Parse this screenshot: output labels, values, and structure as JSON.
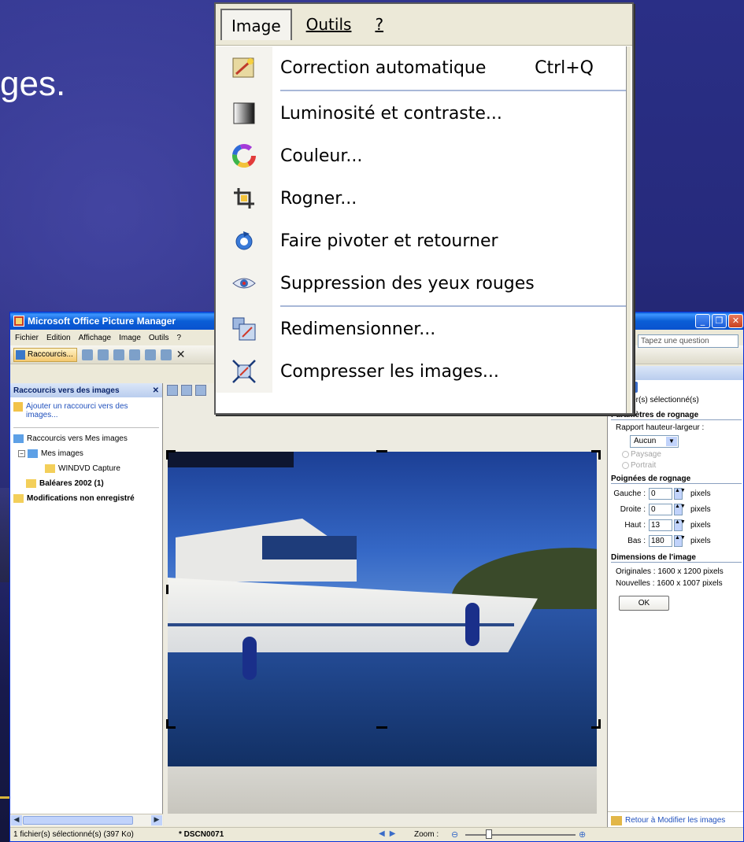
{
  "slide": {
    "title_fragment": "ges."
  },
  "window": {
    "title": "Microsoft Office Picture Manager",
    "menu": [
      "Fichier",
      "Edition",
      "Affichage",
      "Image",
      "Outils",
      "?"
    ],
    "ask_placeholder": "Tapez une question",
    "toolbar_shortcuts_label": "Raccourcis..."
  },
  "left_pane": {
    "header": "Raccourcis vers des images",
    "add_shortcut": "Ajouter un raccourci vers des images...",
    "tree": [
      {
        "label": "Raccourcis vers Mes images",
        "bold": false
      },
      {
        "label": "Mes images",
        "bold": false
      },
      {
        "label": "WINDVD Capture",
        "bold": false
      },
      {
        "label": "Baléares 2002 (1)",
        "bold": true
      },
      {
        "label": "Modifications non enregistré",
        "bold": true
      }
    ]
  },
  "status": {
    "selection": "1 fichier(s) sélectionné(s) (397 Ko)",
    "filename": "* DSCN0071",
    "zoom_label": "Zoom :"
  },
  "right_pane": {
    "header_fragment": "er",
    "selected": "1 fichier(s) sélectionné(s)",
    "crop_params_title": "Paramètres de rognage",
    "ratio_label": "Rapport hauteur-largeur :",
    "ratio_value": "Aucun",
    "landscape": "Paysage",
    "portrait": "Portrait",
    "handles_title": "Poignées de rognage",
    "handles": [
      {
        "label": "Gauche :",
        "value": "0",
        "unit": "pixels"
      },
      {
        "label": "Droite :",
        "value": "0",
        "unit": "pixels"
      },
      {
        "label": "Haut :",
        "value": "13",
        "unit": "pixels"
      },
      {
        "label": "Bas :",
        "value": "180",
        "unit": "pixels"
      }
    ],
    "dims_title": "Dimensions de l'image",
    "original": "Originales :  1600 x 1200 pixels",
    "new": "Nouvelles :  1600 x 1007 pixels",
    "ok": "OK",
    "back_link": "Retour à Modifier les images"
  },
  "image_menu": {
    "bar": [
      {
        "label": "Image",
        "active": true
      },
      {
        "label": "Outils",
        "active": false
      },
      {
        "label": "?",
        "active": false
      }
    ],
    "items": [
      {
        "label": "Correction automatique",
        "shortcut": "Ctrl+Q",
        "icon": "auto-correct-icon"
      },
      {
        "label": "Luminosité et contraste...",
        "icon": "brightness-contrast-icon"
      },
      {
        "label": "Couleur...",
        "icon": "color-wheel-icon"
      },
      {
        "label": "Rogner...",
        "icon": "crop-icon"
      },
      {
        "label": "Faire pivoter et retourner",
        "icon": "rotate-flip-icon"
      },
      {
        "label": "Suppression des yeux rouges",
        "icon": "red-eye-icon"
      },
      {
        "label": "Redimensionner...",
        "icon": "resize-icon"
      },
      {
        "label": "Compresser les images...",
        "icon": "compress-icon"
      }
    ]
  }
}
